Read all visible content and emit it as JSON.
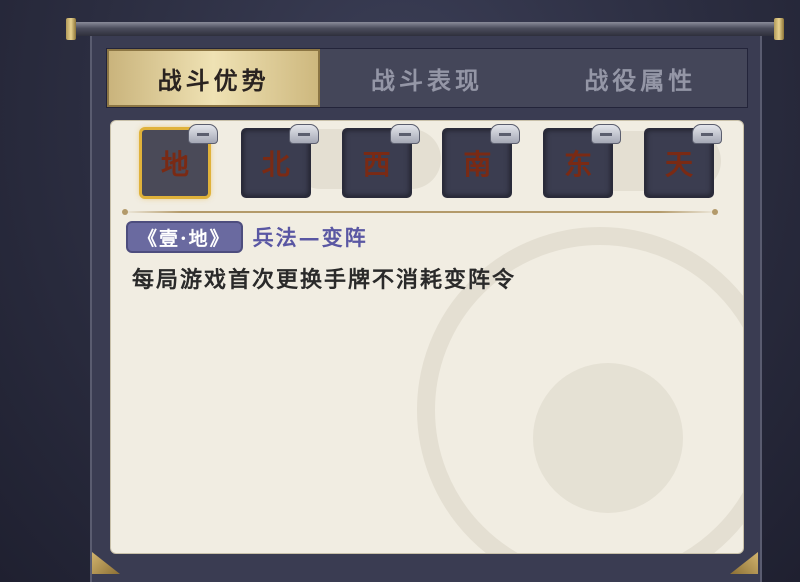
{
  "tabs": [
    {
      "label": "战斗优势",
      "active": true
    },
    {
      "label": "战斗表现",
      "active": false
    },
    {
      "label": "战役属性",
      "active": false
    }
  ],
  "seals": [
    {
      "char": "地",
      "selected": true
    },
    {
      "char": "北",
      "selected": false
    },
    {
      "char": "西",
      "selected": false
    },
    {
      "char": "南",
      "selected": false
    },
    {
      "char": "东",
      "selected": false
    },
    {
      "char": "天",
      "selected": false
    }
  ],
  "detail": {
    "badge": "《壹·地》",
    "skill_name": "兵法—变阵",
    "description": "每局游戏首次更换手牌不消耗变阵令"
  },
  "colors": {
    "active_tab": "#efe2b4",
    "seal_highlight": "#e0b23a",
    "badge": "#6a6aa0",
    "skill_name": "#5a57a3"
  }
}
